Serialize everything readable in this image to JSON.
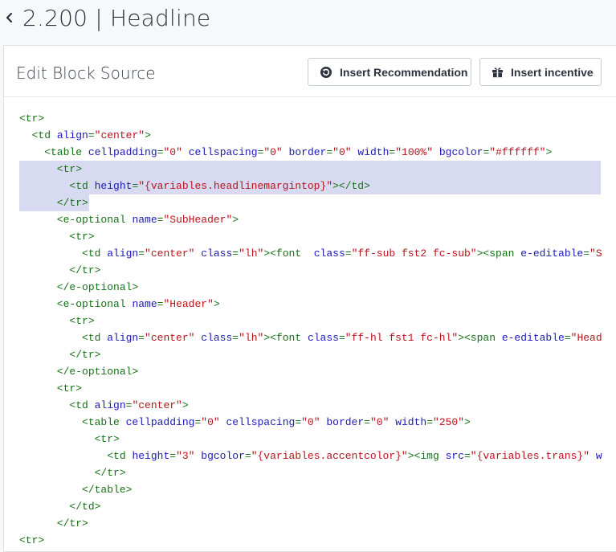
{
  "header": {
    "back_icon": "chevron-left-icon",
    "title": "2.200 | Headline"
  },
  "panel": {
    "title": "Edit Block Source",
    "buttons": {
      "recommendation": {
        "label": "Insert Recommendation",
        "icon": "refresh-icon"
      },
      "incentive": {
        "label": "Insert incentive",
        "icon": "gift-icon"
      }
    }
  },
  "colors": {
    "tag": "#167016",
    "attribute": "#1a1ab8",
    "value": "#b8141a",
    "selection": "#d7daf0"
  },
  "code_lines": [
    [
      [
        "t",
        "<tr>"
      ]
    ],
    [
      [
        "t",
        "  <td "
      ],
      [
        "a",
        "align"
      ],
      [
        "t",
        "="
      ],
      [
        "v",
        "\"center\""
      ],
      [
        "t",
        ">"
      ]
    ],
    [
      [
        "t",
        "    <table "
      ],
      [
        "a",
        "cellpadding"
      ],
      [
        "t",
        "="
      ],
      [
        "v",
        "\"0\""
      ],
      [
        "t",
        " "
      ],
      [
        "a",
        "cellspacing"
      ],
      [
        "t",
        "="
      ],
      [
        "v",
        "\"0\""
      ],
      [
        "t",
        " "
      ],
      [
        "a",
        "border"
      ],
      [
        "t",
        "="
      ],
      [
        "v",
        "\"0\""
      ],
      [
        "t",
        " "
      ],
      [
        "a",
        "width"
      ],
      [
        "t",
        "="
      ],
      [
        "v",
        "\"100%\""
      ],
      [
        "t",
        " "
      ],
      [
        "a",
        "bgcolor"
      ],
      [
        "t",
        "="
      ],
      [
        "v",
        "\"#ffffff\""
      ],
      [
        "t",
        ">"
      ]
    ],
    [
      [
        "t",
        "      <tr>"
      ]
    ],
    [
      [
        "t",
        "        <td "
      ],
      [
        "a",
        "height"
      ],
      [
        "t",
        "="
      ],
      [
        "v",
        "\"{variables.headlinemargintop}\""
      ],
      [
        "t",
        "></td>"
      ]
    ],
    [
      [
        "t",
        "      </tr>"
      ]
    ],
    [
      [
        "t",
        "      <e-optional "
      ],
      [
        "a",
        "name"
      ],
      [
        "t",
        "="
      ],
      [
        "v",
        "\"SubHeader\""
      ],
      [
        "t",
        ">"
      ]
    ],
    [
      [
        "t",
        "        <tr>"
      ]
    ],
    [
      [
        "t",
        "          <td "
      ],
      [
        "a",
        "align"
      ],
      [
        "t",
        "="
      ],
      [
        "v",
        "\"center\""
      ],
      [
        "t",
        " "
      ],
      [
        "a",
        "class"
      ],
      [
        "t",
        "="
      ],
      [
        "v",
        "\"lh\""
      ],
      [
        "t",
        "><font  "
      ],
      [
        "a",
        "class"
      ],
      [
        "t",
        "="
      ],
      [
        "v",
        "\"ff-sub fst2 fc-sub\""
      ],
      [
        "t",
        "><span "
      ],
      [
        "a",
        "e-editable"
      ],
      [
        "t",
        "="
      ],
      [
        "v",
        "\"S"
      ]
    ],
    [
      [
        "t",
        "        </tr>"
      ]
    ],
    [
      [
        "t",
        "      </e-optional>"
      ]
    ],
    [
      [
        "t",
        "      <e-optional "
      ],
      [
        "a",
        "name"
      ],
      [
        "t",
        "="
      ],
      [
        "v",
        "\"Header\""
      ],
      [
        "t",
        ">"
      ]
    ],
    [
      [
        "t",
        "        <tr>"
      ]
    ],
    [
      [
        "t",
        "          <td "
      ],
      [
        "a",
        "align"
      ],
      [
        "t",
        "="
      ],
      [
        "v",
        "\"center\""
      ],
      [
        "t",
        " "
      ],
      [
        "a",
        "class"
      ],
      [
        "t",
        "="
      ],
      [
        "v",
        "\"lh\""
      ],
      [
        "t",
        "><font "
      ],
      [
        "a",
        "class"
      ],
      [
        "t",
        "="
      ],
      [
        "v",
        "\"ff-hl fst1 fc-hl\""
      ],
      [
        "t",
        "><span "
      ],
      [
        "a",
        "e-editable"
      ],
      [
        "t",
        "="
      ],
      [
        "v",
        "\"Head"
      ]
    ],
    [
      [
        "t",
        "        </tr>"
      ]
    ],
    [
      [
        "t",
        "      </e-optional>"
      ]
    ],
    [
      [
        "t",
        "      <tr>"
      ]
    ],
    [
      [
        "t",
        "        <td "
      ],
      [
        "a",
        "align"
      ],
      [
        "t",
        "="
      ],
      [
        "v",
        "\"center\""
      ],
      [
        "t",
        ">"
      ]
    ],
    [
      [
        "t",
        "          <table "
      ],
      [
        "a",
        "cellpadding"
      ],
      [
        "t",
        "="
      ],
      [
        "v",
        "\"0\""
      ],
      [
        "t",
        " "
      ],
      [
        "a",
        "cellspacing"
      ],
      [
        "t",
        "="
      ],
      [
        "v",
        "\"0\""
      ],
      [
        "t",
        " "
      ],
      [
        "a",
        "border"
      ],
      [
        "t",
        "="
      ],
      [
        "v",
        "\"0\""
      ],
      [
        "t",
        " "
      ],
      [
        "a",
        "width"
      ],
      [
        "t",
        "="
      ],
      [
        "v",
        "\"250\""
      ],
      [
        "t",
        ">"
      ]
    ],
    [
      [
        "t",
        "            <tr>"
      ]
    ],
    [
      [
        "t",
        "              <td "
      ],
      [
        "a",
        "height"
      ],
      [
        "t",
        "="
      ],
      [
        "v",
        "\"3\""
      ],
      [
        "t",
        " "
      ],
      [
        "a",
        "bgcolor"
      ],
      [
        "t",
        "="
      ],
      [
        "v",
        "\"{variables.accentcolor}\""
      ],
      [
        "t",
        "><img "
      ],
      [
        "a",
        "src"
      ],
      [
        "t",
        "="
      ],
      [
        "v",
        "\"{variables.trans}\""
      ],
      [
        "t",
        " "
      ],
      [
        "a",
        "w"
      ]
    ],
    [
      [
        "t",
        "            </tr>"
      ]
    ],
    [
      [
        "t",
        "          </table>"
      ]
    ],
    [
      [
        "t",
        "        </td>"
      ]
    ],
    [
      [
        "t",
        "      </tr>"
      ]
    ],
    [
      [
        "t",
        "<tr>"
      ]
    ]
  ]
}
